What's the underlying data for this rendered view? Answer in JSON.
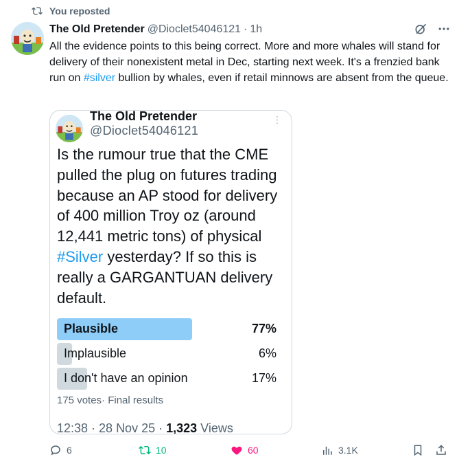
{
  "repost": {
    "icon": "repost-icon",
    "label": "You reposted"
  },
  "tweet": {
    "name": "The Old Pretender",
    "handle": "@Dioclet54046121",
    "separator": "·",
    "time": "1h",
    "text_before": "All the evidence points to this being correct. More and more whales will stand for delivery of their nonexistent metal in Dec, starting next week. It's a frenzied bank run on ",
    "hashtag": "#silver",
    "text_after": " bullion by whales, even if retail minnows are absent from the queue."
  },
  "quote": {
    "name": "The Old Pretender",
    "handle": "@Dioclet54046121",
    "more": "⋮",
    "text_before": "Is the rumour true that the CME pulled the plug on futures trading because an AP stood for delivery of 400 million Troy oz (around 12,441 metric tons) of physical ",
    "hashtag": "#Silver",
    "text_after": " yesterday? If so this is really a GARGANTUAN delivery default.",
    "poll": {
      "options": [
        {
          "label": "Plausible",
          "percent": "77%",
          "value": 77,
          "winner": true
        },
        {
          "label": "Implausible",
          "percent": "6%",
          "value": 6,
          "winner": false
        },
        {
          "label": "I don't have an opinion",
          "percent": "17%",
          "value": 17,
          "winner": false
        }
      ],
      "votes": "175 votes",
      "status": "Final results",
      "winner_color": "#8ecdf8",
      "other_color": "#cfd9de"
    },
    "timestamp": "12:38 · 28 Nov 25 · ",
    "views_count": "1,323",
    "views_label": " Views"
  },
  "actions": {
    "reply": "6",
    "repost": "10",
    "like": "60",
    "views": "3.1K",
    "repost_color": "#00ba7c",
    "like_color": "#f91880"
  }
}
